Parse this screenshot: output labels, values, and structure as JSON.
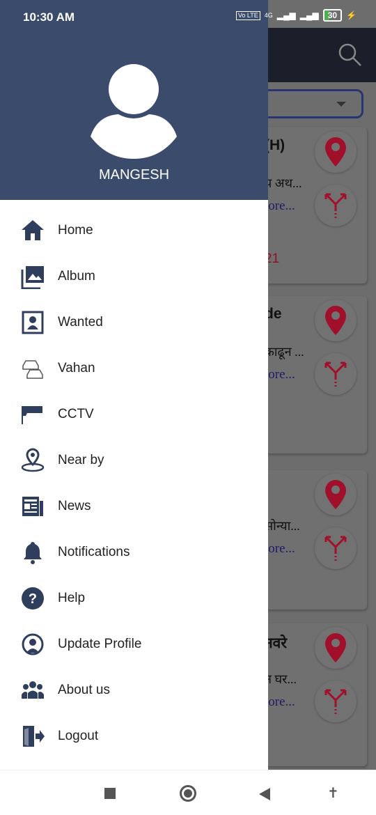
{
  "status": {
    "time": "10:30 AM",
    "volte": "Vo LTE",
    "network": "4G",
    "battery": "30"
  },
  "user": {
    "name": "MANGESH"
  },
  "menu": [
    {
      "label": "Home",
      "icon": "home-icon"
    },
    {
      "label": "Album",
      "icon": "album-icon"
    },
    {
      "label": "Wanted",
      "icon": "wanted-icon"
    },
    {
      "label": "Vahan",
      "icon": "vehicle-icon"
    },
    {
      "label": "CCTV",
      "icon": "cctv-icon"
    },
    {
      "label": "Near by",
      "icon": "nearby-icon"
    },
    {
      "label": "News",
      "icon": "news-icon"
    },
    {
      "label": "Notifications",
      "icon": "bell-icon"
    },
    {
      "label": "Help",
      "icon": "help-icon"
    },
    {
      "label": "Update Profile",
      "icon": "update-profile-icon"
    },
    {
      "label": "About us",
      "icon": "about-us-icon"
    },
    {
      "label": "Logout",
      "icon": "logout-icon"
    }
  ],
  "cards": [
    {
      "title": "(H)",
      "desc": "प अथ...",
      "more": "lore...",
      "date": "21"
    },
    {
      "title": "de",
      "desc": "काढून ...",
      "more": "lore...",
      "date": ""
    },
    {
      "title": "",
      "desc": "सोन्या...",
      "more": "lore...",
      "date": ""
    },
    {
      "title": "नवरे",
      "desc": "न घर...",
      "more": "lore...",
      "date": ""
    }
  ],
  "colors": {
    "drawer_header": "#3a4b6c",
    "icon": "#2f3e5c",
    "pin": "#a0102a"
  }
}
